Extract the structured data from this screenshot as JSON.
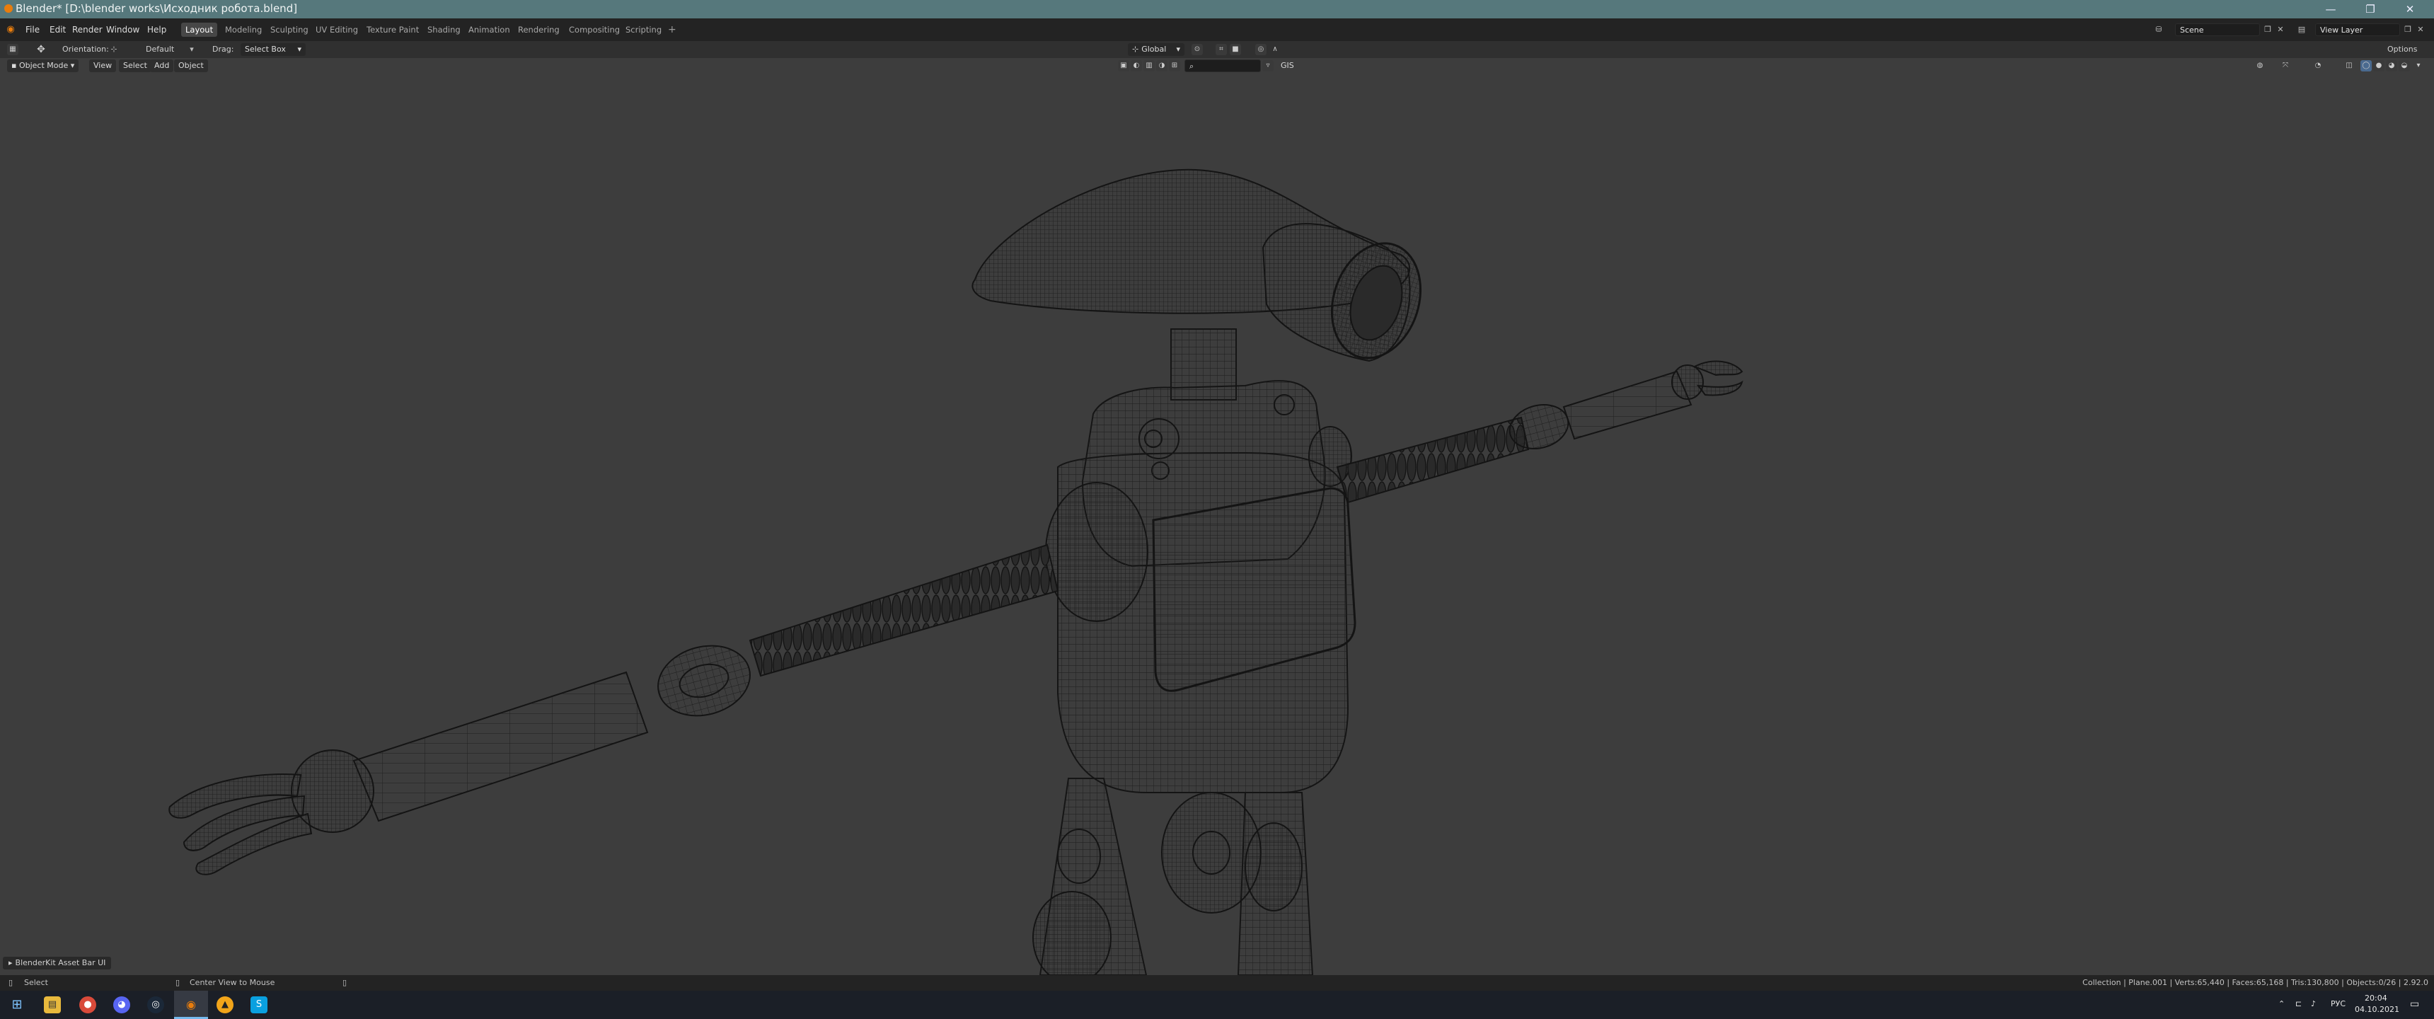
{
  "titlebar": {
    "title": "Blender* [D:\\blender works\\Исходник робота.blend]",
    "minimize": "—",
    "maximize": "❐",
    "close": "✕"
  },
  "menus": [
    "File",
    "Edit",
    "Render",
    "Window",
    "Help"
  ],
  "workspaces": [
    "Layout",
    "Modeling",
    "Sculpting",
    "UV Editing",
    "Texture Paint",
    "Shading",
    "Animation",
    "Rendering",
    "Compositing",
    "Scripting"
  ],
  "active_workspace": "Layout",
  "scene": {
    "name": "Scene"
  },
  "view_layer": {
    "name": "View Layer"
  },
  "tool_header": {
    "orientation_label": "Orientation:",
    "orientation_value": "Default",
    "drag_label": "Drag:",
    "drag_value": "Select Box",
    "transform_orientation": "Global",
    "options": "Options"
  },
  "viewport_header": {
    "mode": "Object Mode",
    "menus": [
      "View",
      "Select",
      "Add",
      "Object"
    ],
    "gis": "GIS"
  },
  "blenderkit": {
    "label": "BlenderKit Asset Bar UI"
  },
  "statusbar": {
    "left_action": "Select",
    "middle_action": "Center View to Mouse",
    "stats": "Collection | Plane.001 | Verts:65,440 | Faces:65,168 | Tris:130,800 | Objects:0/26 | 2.92.0"
  },
  "taskbar": {
    "language": "РУС",
    "time": "20:04",
    "date": "04.10.2021"
  },
  "colors": {
    "titlebar": "#56787c",
    "viewport_bg": "#3d3d3d",
    "wire": "#151515",
    "accent": "#e87d0d"
  }
}
